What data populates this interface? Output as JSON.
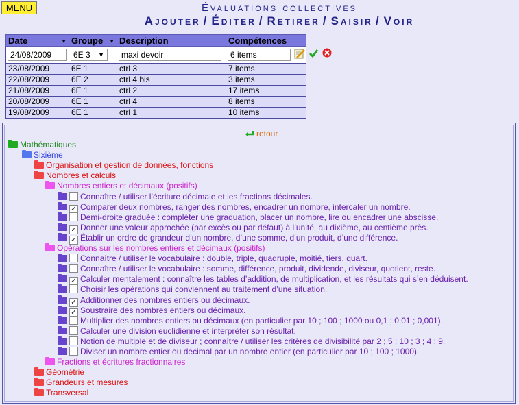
{
  "menu_label": "MENU",
  "title": "Évaluations collectives",
  "nav": [
    "Ajouter",
    "Éditer",
    "Retirer",
    "Saisir",
    "Voir"
  ],
  "table": {
    "headers": [
      "Date",
      "Groupe",
      "Description",
      "Compétences"
    ],
    "edit": {
      "date": "24/08/2009",
      "group": "6E 3",
      "description": "maxi devoir",
      "competences": "6 items"
    },
    "rows": [
      [
        "23/08/2009",
        "6E 1",
        "ctrl 3",
        "7 items"
      ],
      [
        "22/08/2009",
        "6E 2",
        "ctrl 4 bis",
        "3 items"
      ],
      [
        "21/08/2009",
        "6E 1",
        "ctrl 2",
        "17 items"
      ],
      [
        "20/08/2009",
        "6E 1",
        "ctrl 4",
        "8 items"
      ],
      [
        "19/08/2009",
        "6E 1",
        "ctrl 1",
        "10 items"
      ]
    ]
  },
  "retour": "retour",
  "tree": [
    {
      "text": "Mathématiques",
      "folder": "green",
      "level": 0
    },
    {
      "text": "Sixième",
      "folder": "blue",
      "level": 1
    },
    {
      "text": "Organisation et gestion de données, fonctions",
      "folder": "red",
      "level": 2
    },
    {
      "text": "Nombres et calculs",
      "folder": "red",
      "level": 2
    },
    {
      "text": "Nombres entiers et décimaux (positifs)",
      "folder": "pink",
      "level": 3
    },
    {
      "text": "Connaître / utiliser l’écriture décimale et les fractions décimales.",
      "item": true,
      "checked": false
    },
    {
      "text": "Comparer deux nombres, ranger des nombres, encadrer un nombre, intercaler un nombre.",
      "item": true,
      "checked": true
    },
    {
      "text": "Demi-droite graduée : compléter une graduation, placer un nombre, lire ou encadrer une abscisse.",
      "item": true,
      "checked": false
    },
    {
      "text": "Donner une valeur approchée (par excès ou par défaut) à l’unité, au dixième, au centième près.",
      "item": true,
      "checked": true
    },
    {
      "text": "Établir un ordre de grandeur d’un nombre, d’une somme, d’un produit, d’une différence.",
      "item": true,
      "checked": true
    },
    {
      "text": "Opérations sur les nombres entiers et décimaux (positifs)",
      "folder": "pink",
      "level": 3
    },
    {
      "text": "Connaître / utiliser le vocabulaire : double, triple, quadruple, moitié, tiers, quart.",
      "item": true,
      "checked": false
    },
    {
      "text": "Connaître / utiliser le vocabulaire : somme, différence, produit, dividende, diviseur, quotient, reste.",
      "item": true,
      "checked": false
    },
    {
      "text": "Calculer mentalement : connaître les tables d’addition, de multiplication, et les résultats qui s’en déduisent.",
      "item": true,
      "checked": true
    },
    {
      "text": "Choisir les opérations qui conviennent au traitement d’une situation.",
      "item": true,
      "checked": false
    },
    {
      "text": "Additionner des nombres entiers ou décimaux.",
      "item": true,
      "checked": true
    },
    {
      "text": "Soustraire des nombres entiers ou décimaux.",
      "item": true,
      "checked": true
    },
    {
      "text": "Multiplier des nombres entiers ou décimaux (en particulier par 10 ; 100 ; 1000 ou 0,1 ; 0,01 ; 0,001).",
      "item": true,
      "checked": false
    },
    {
      "text": "Calculer une division euclidienne et interpréter son résultat.",
      "item": true,
      "checked": false
    },
    {
      "text": "Notion de multiple et de diviseur ; connaître / utiliser les critères de divisibilité par 2 ; 5 ; 10 ; 3 ; 4 ; 9.",
      "item": true,
      "checked": false
    },
    {
      "text": "Diviser un nombre entier ou décimal par un nombre entier (en particulier par 10 ; 100 ; 1000).",
      "item": true,
      "checked": false
    },
    {
      "text": "Fractions et écritures fractionnaires",
      "folder": "pink",
      "level": 3
    },
    {
      "text": "Géométrie",
      "folder": "red",
      "level": 2
    },
    {
      "text": "Grandeurs et mesures",
      "folder": "red",
      "level": 2
    },
    {
      "text": "Transversal",
      "folder": "red",
      "level": 2
    }
  ]
}
